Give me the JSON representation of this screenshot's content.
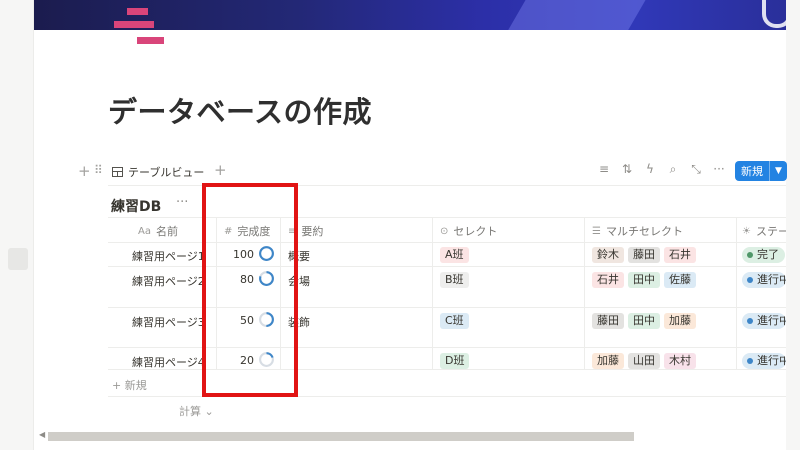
{
  "page": {
    "title": "データベースの作成"
  },
  "toolbar": {
    "view_tab_label": "テーブルビュー",
    "new_button_label": "新規",
    "tools": [
      "filter-icon",
      "sort-icon",
      "lightning-icon",
      "search-icon",
      "expand-icon",
      "more-icon"
    ]
  },
  "database": {
    "title": "練習DB",
    "columns": [
      {
        "icon": "Aa",
        "label": "名前"
      },
      {
        "icon": "#",
        "label": "完成度"
      },
      {
        "icon": "≡",
        "label": "要約"
      },
      {
        "icon": "⊙",
        "label": "セレクト"
      },
      {
        "icon": "☰",
        "label": "マルチセレクト"
      },
      {
        "icon": "☀",
        "label": "ステータス"
      }
    ],
    "rows": [
      {
        "name": "練習用ページ1",
        "progress": 100,
        "summary": "概要",
        "select": "A班",
        "multi": [
          "鈴木",
          "藤田",
          "石井"
        ],
        "status": "完了"
      },
      {
        "name": "練習用ページ2",
        "progress": 80,
        "summary": "会場",
        "select": "B班",
        "multi": [
          "石井",
          "田中",
          "佐藤"
        ],
        "status": "進行中"
      },
      {
        "name": "練習用ページ3",
        "progress": 50,
        "summary": "装飾",
        "select": "C班",
        "multi": [
          "藤田",
          "田中",
          "加藤"
        ],
        "status": "進行中"
      },
      {
        "name": "練習用ページ4",
        "progress": 20,
        "summary": "",
        "select": "D班",
        "multi": [
          "加藤",
          "山田",
          "木村"
        ],
        "status": "進行中"
      }
    ],
    "add_row_label": "新規",
    "calc_label": "計算"
  },
  "colors": {
    "accent_blue": "#2383e2",
    "highlight_red": "#e11414",
    "progress_ring": "#3e86c8",
    "select_tags": {
      "A班": "#fbe4e4",
      "B班": "#eeeeed",
      "C班": "#dbeaf5",
      "D班": "#dcefe3"
    },
    "people_tags": {
      "鈴木": "#f0e6e0",
      "藤田": "#e3e2e0",
      "石井": "#fbe4e4",
      "田中": "#dcefe3",
      "佐藤": "#dbeaf5",
      "加藤": "#fbe8d9",
      "山田": "#e3e2e0",
      "木村": "#f8e2ea"
    }
  }
}
